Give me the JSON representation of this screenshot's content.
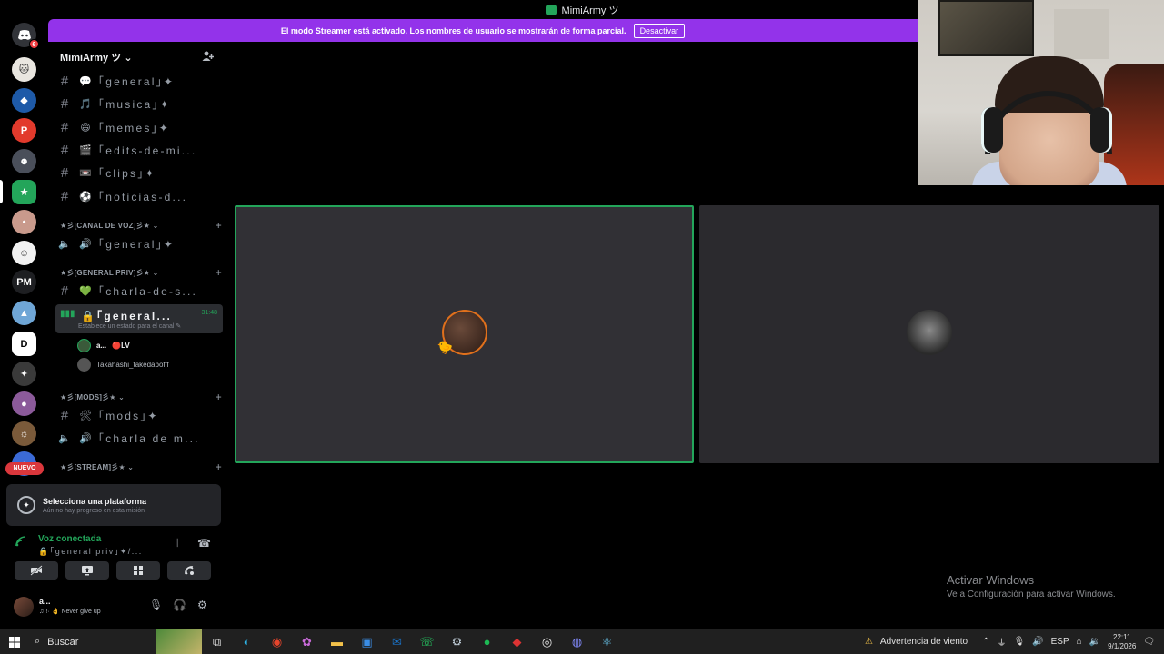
{
  "window": {
    "title": "MimiArmy ツ"
  },
  "rail": {
    "badge_count": "6",
    "pm_label": "PM",
    "new_label": "NUEVO"
  },
  "banner": {
    "text": "El modo Streamer está activado. Los nombres de usuario se mostrarán de forma parcial.",
    "button": "Desactivar"
  },
  "server": {
    "name": "MimiArmy ツ"
  },
  "channels": {
    "text1": {
      "emoji": "💬",
      "label": "｢general｣✦"
    },
    "text2": {
      "emoji": "🎵",
      "label": "｢musica｣✦"
    },
    "text3": {
      "emoji": "😄",
      "label": "｢memes｣✦"
    },
    "text4": {
      "emoji": "🎬",
      "label": "｢edits-de-mi..."
    },
    "text5": {
      "emoji": "📼",
      "label": "｢clips｣✦"
    },
    "text6": {
      "emoji": "⚽",
      "label": "｢noticias-d..."
    },
    "cat_voice": "★彡[CANAL DE VOZ]彡★",
    "voice1": {
      "emoji": "🔊",
      "label": "｢general｣✦"
    },
    "cat_priv": "★彡[GENERAL PRIV]彡★",
    "priv1": {
      "emoji": "💚",
      "label": "｢charla-de-s..."
    },
    "active": {
      "label": "｢general...",
      "time": "31:48",
      "status": "Establece un estado para el canal"
    },
    "voice_users": [
      {
        "name": "a...",
        "tag": "LV"
      },
      {
        "name": "Takahashi_takedabofff"
      }
    ],
    "cat_mods": "★彡[MODS]彡★",
    "mods1": {
      "emoji": "🛠",
      "label": "｢mods｣✦"
    },
    "mods2": {
      "emoji": "🔊",
      "label": "｢charla de m..."
    },
    "cat_stream": "★彡[STREAM]彡★"
  },
  "quest": {
    "title": "Selecciona una plataforma",
    "subtitle": "Aún no hay progreso en esta misión"
  },
  "voice_panel": {
    "title": "Voz conectada",
    "channel": "🔒｢general priv｣✦/..."
  },
  "user_panel": {
    "name": "a...",
    "status": "Never give up"
  },
  "activate": {
    "title": "Activar Windows",
    "subtitle": "Ve a Configuración para activar Windows."
  },
  "taskbar": {
    "search": "Buscar",
    "weather": "Advertencia de viento",
    "lang": "ESP",
    "time": "22:11",
    "date": "9/1/2026"
  },
  "colors": {
    "accent": "#9333ea",
    "speaking": "#23a55a",
    "danger": "#da373c"
  }
}
